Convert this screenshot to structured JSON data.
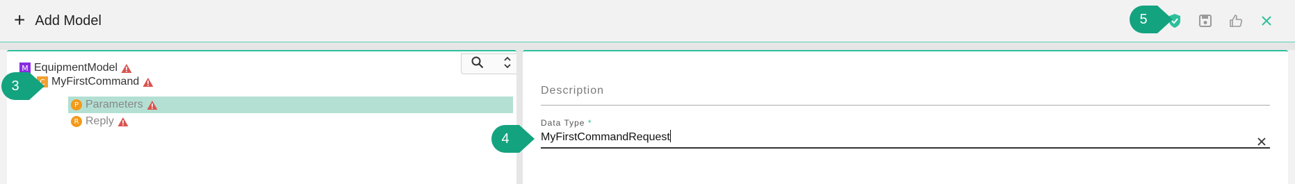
{
  "header": {
    "title": "Add Model",
    "actions": [
      "check-shield-icon",
      "save-icon",
      "thumbs-up-icon",
      "close-icon"
    ]
  },
  "tree": {
    "nodes": [
      {
        "badge": "M",
        "label": "EquipmentModel"
      },
      {
        "badge": "C",
        "label": "MyFirstCommand"
      },
      {
        "badge": "P",
        "label": "Parameters"
      },
      {
        "badge": "R",
        "label": "Reply"
      }
    ]
  },
  "form": {
    "description_label": "Description",
    "data_type_label": "Data Type",
    "required_mark": "*",
    "data_type_value": "MyFirstCommandRequest"
  },
  "callouts": [
    "3",
    "4",
    "5"
  ],
  "colors": {
    "accent": "#2dbf9c",
    "callout": "#13a37f",
    "warning": "#d9534f",
    "selected_row": "#b3e0d3"
  }
}
